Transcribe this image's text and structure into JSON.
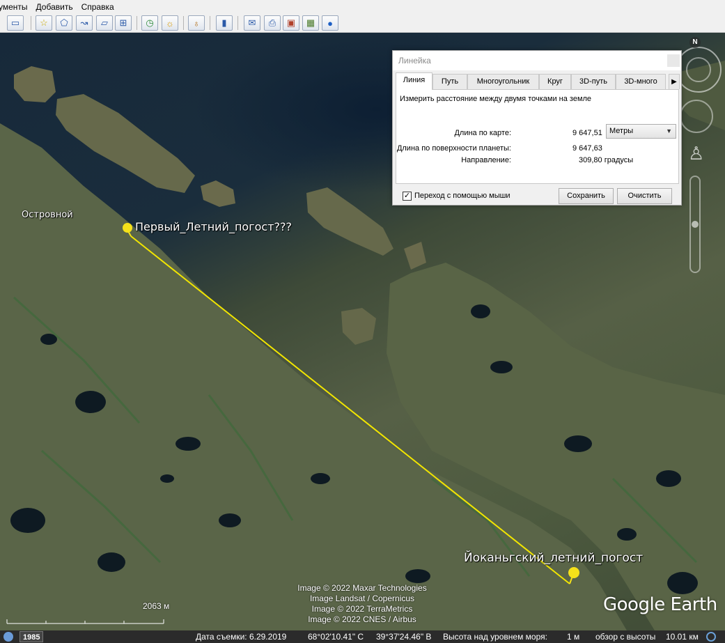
{
  "menu": {
    "items": [
      "ументы",
      "Добавить",
      "Справка"
    ]
  },
  "toolbar": {
    "buttons": [
      {
        "icon": "sidebar-icon",
        "glyph": "▭"
      },
      {
        "icon": "add-placemark-icon",
        "glyph": "☆"
      },
      {
        "icon": "add-polygon-icon",
        "glyph": "⬠"
      },
      {
        "icon": "add-path-icon",
        "glyph": "↝"
      },
      {
        "icon": "add-overlay-icon",
        "glyph": "▱"
      },
      {
        "icon": "record-tour-icon",
        "glyph": "⊞"
      },
      {
        "icon": "historical-imagery-icon",
        "glyph": "◷"
      },
      {
        "icon": "sunlight-icon",
        "glyph": "☼"
      },
      {
        "icon": "planets-icon",
        "glyph": "♁"
      },
      {
        "icon": "ruler-icon",
        "glyph": "▮"
      },
      {
        "icon": "email-icon",
        "glyph": "✉"
      },
      {
        "icon": "print-icon",
        "glyph": "⎙"
      },
      {
        "icon": "save-image-icon",
        "glyph": "▣"
      },
      {
        "icon": "view-in-maps-icon",
        "glyph": "▦"
      },
      {
        "icon": "earth-gallery-icon",
        "glyph": "●"
      }
    ]
  },
  "map": {
    "labels": {
      "town": "Островной",
      "pin1": "Первый_Летний_погост???",
      "pin2": "Йоканьгский_летний_погост"
    },
    "attribution": [
      "Image © 2022 Maxar Technologies",
      "Image Landsat / Copernicus",
      "Image © 2022 TerraMetrics",
      "Image © 2022 CNES / Airbus"
    ],
    "scale": "2063 м",
    "logo": "Google Earth",
    "compass_letter": "N",
    "line_color": "#f2e600",
    "pin_color": "#f5e11a"
  },
  "ruler": {
    "title": "Линейка",
    "tabs": [
      "Линия",
      "Путь",
      "Многоугольник",
      "Круг",
      "3D-путь",
      "3D-много"
    ],
    "active_tab": "Линия",
    "description": "Измерить расстояние между двумя точками на земле",
    "map_length_label": "Длина по карте:",
    "map_length_value": "9 647,51",
    "unit": "Метры",
    "surface_length_label": "Длина по поверхности планеты:",
    "surface_length_value": "9 647,63",
    "direction_label": "Направление:",
    "direction_value": "309,80 градусы",
    "mouse_nav_label": "Переход с помощью мыши",
    "mouse_nav_checked": true,
    "save_label": "Сохранить",
    "clear_label": "Очистить"
  },
  "status": {
    "year": "1985",
    "capture_date": "Дата съемки: 6.29.2019",
    "lat": "68°02'10.41\" С",
    "lon": "39°37'24.46\" В",
    "elevation_label": "Высота над уровнем моря:",
    "elevation_value": "1 м",
    "eye_alt_label": "обзор с высоты",
    "eye_alt_value": "10.01 км"
  }
}
